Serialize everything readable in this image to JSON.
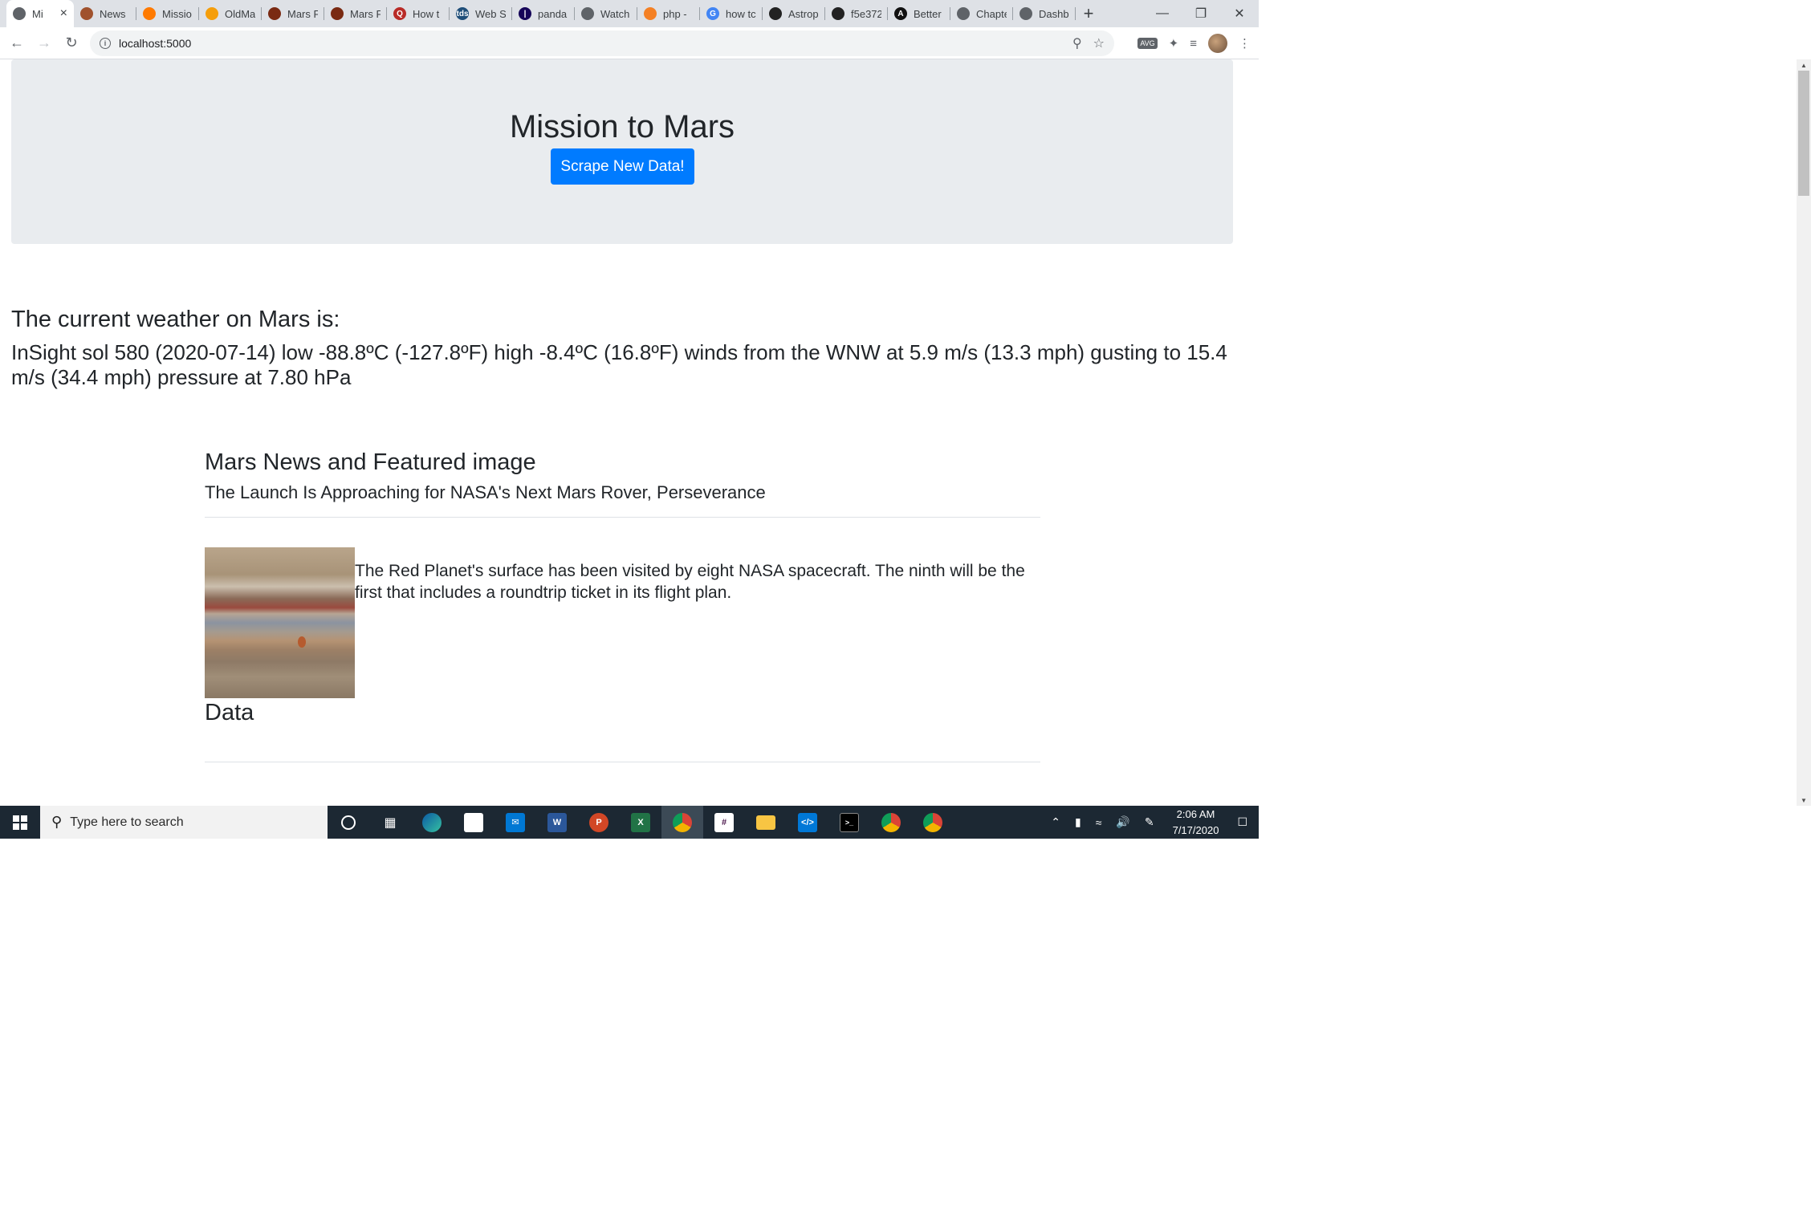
{
  "browser": {
    "tabs": [
      {
        "title": "Mi",
        "color": "#5f6368",
        "glyph": "",
        "active": true
      },
      {
        "title": "News",
        "color": "#a0522d",
        "glyph": ""
      },
      {
        "title": "Missio",
        "color": "#ff7a00",
        "glyph": ""
      },
      {
        "title": "OldMa",
        "color": "#f59e0b",
        "glyph": ""
      },
      {
        "title": "Mars F",
        "color": "#7a2a12",
        "glyph": ""
      },
      {
        "title": "Mars F",
        "color": "#7a2a12",
        "glyph": ""
      },
      {
        "title": "How t",
        "color": "#b92b27",
        "glyph": "Q"
      },
      {
        "title": "Web S",
        "color": "#1f4e79",
        "glyph": "tds"
      },
      {
        "title": "panda",
        "color": "#150458",
        "glyph": "|"
      },
      {
        "title": "Watch",
        "color": "#5f6368",
        "glyph": ""
      },
      {
        "title": "php -",
        "color": "#f48024",
        "glyph": ""
      },
      {
        "title": "how tc",
        "color": "#4285f4",
        "glyph": "G"
      },
      {
        "title": "Astrop",
        "color": "#222222",
        "glyph": ""
      },
      {
        "title": "f5e372",
        "color": "#222222",
        "glyph": ""
      },
      {
        "title": "Better",
        "color": "#111111",
        "glyph": "A"
      },
      {
        "title": "Chapte",
        "color": "#5f6368",
        "glyph": ""
      },
      {
        "title": "Dashb",
        "color": "#5f6368",
        "glyph": ""
      }
    ],
    "url": "localhost:5000"
  },
  "page": {
    "title": "Mission to Mars",
    "scrape_button": "Scrape New Data!",
    "weather_heading": "The current weather on Mars is:",
    "weather_text": "InSight sol 580 (2020-07-14) low -88.8ºC (-127.8ºF) high -8.4ºC (16.8ºF) winds from the WNW at 5.9 m/s (13.3 mph) gusting to 15.4 m/s (34.4 mph) pressure at 7.80 hPa",
    "news_heading": "Mars News and Featured image",
    "news_title": "The Launch Is Approaching for NASA's Next Mars Rover, Perseverance",
    "news_paragraph": "The Red Planet's surface has been visited by eight NASA spacecraft. The ninth will be the first that includes a roundtrip ticket in its flight plan.",
    "data_heading": "Data"
  },
  "taskbar": {
    "search_placeholder": "Type here to search",
    "time": "2:06 AM",
    "date": "7/17/2020"
  }
}
